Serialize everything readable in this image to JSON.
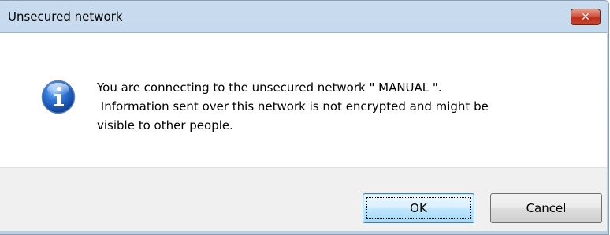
{
  "window": {
    "title": "Unsecured network",
    "close_glyph": "✕"
  },
  "message": {
    "icon": "info-icon",
    "lines": [
      "You are connecting to the unsecured network \" MANUAL \".",
      " Information sent over this network is not encrypted and might be",
      "visible to other people."
    ]
  },
  "buttons": {
    "ok_label": "OK",
    "cancel_label": "Cancel"
  },
  "colors": {
    "info_icon": "#1f5fbf",
    "close_button": "#c7452f"
  }
}
